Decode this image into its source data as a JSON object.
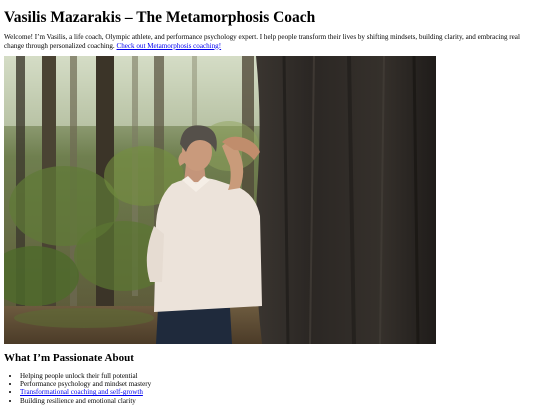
{
  "header": {
    "title": "Vasilis Mazarakis – The Metamorphosis Coach"
  },
  "intro": {
    "text": "Welcome! I’m Vasilis, a life coach, Olympic athlete, and performance psychology expert. I help people transform their lives by shifting mindsets, building clarity, and embracing real change through personalized coaching.",
    "link_label": "Check out Metamorphosis coaching!"
  },
  "photo": {
    "icon": "portrait-photo"
  },
  "passions": {
    "heading": "What I’m Passionate About",
    "items": [
      {
        "label": "Helping people unlock their full potential"
      },
      {
        "label": "Performance psychology and mindset mastery"
      },
      {
        "label": "Transformational coaching and self-growth"
      },
      {
        "label": "Building resilience and emotional clarity"
      }
    ]
  }
}
